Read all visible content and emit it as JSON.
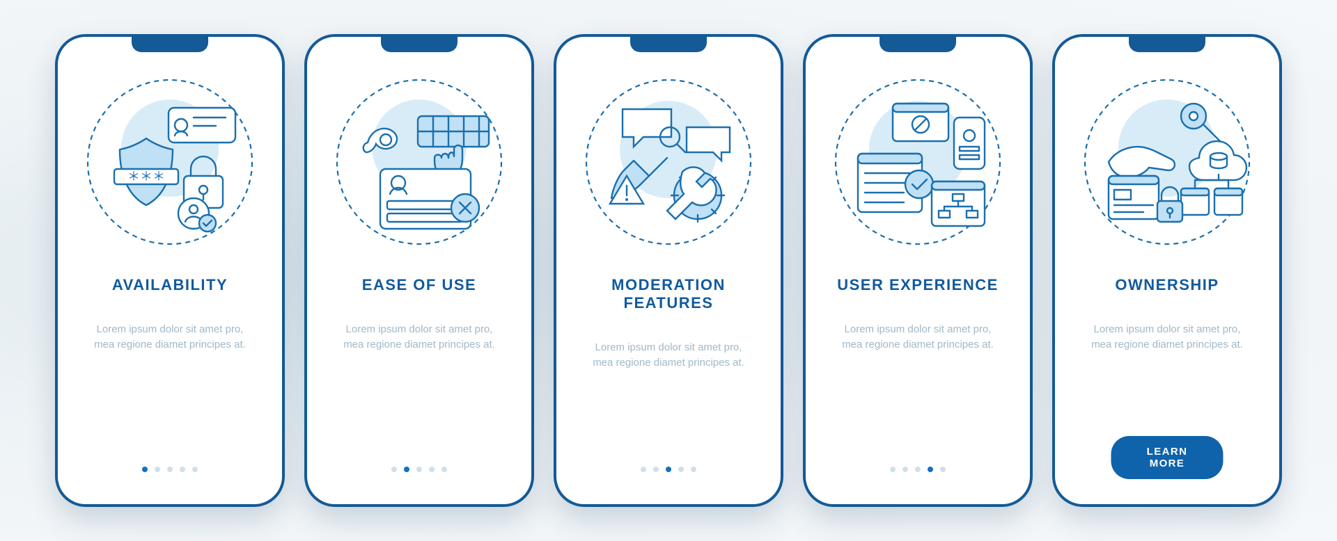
{
  "colors": {
    "primary": "#145a96",
    "accent": "#1a6fae",
    "fill": "#bfe0f5",
    "muted": "#9fb8c9"
  },
  "screens": [
    {
      "icon": "availability-icon",
      "title": "AVAILABILITY",
      "description": "Lorem ipsum dolor sit amet pro, mea regione diamet principes at.",
      "activeDot": 0,
      "dotCount": 5,
      "showDots": true,
      "cta": null
    },
    {
      "icon": "ease-of-use-icon",
      "title": "EASE OF USE",
      "description": "Lorem ipsum dolor sit amet pro, mea regione diamet principes at.",
      "activeDot": 1,
      "dotCount": 5,
      "showDots": true,
      "cta": null
    },
    {
      "icon": "moderation-features-icon",
      "title": "MODERATION FEATURES",
      "description": "Lorem ipsum dolor sit amet pro, mea regione diamet principes at.",
      "activeDot": 2,
      "dotCount": 5,
      "showDots": true,
      "cta": null
    },
    {
      "icon": "user-experience-icon",
      "title": "USER EXPERIENCE",
      "description": "Lorem ipsum dolor sit amet pro, mea regione diamet principes at.",
      "activeDot": 3,
      "dotCount": 5,
      "showDots": true,
      "cta": null
    },
    {
      "icon": "ownership-icon",
      "title": "OWNERSHIP",
      "description": "Lorem ipsum dolor sit amet pro, mea regione diamet principes at.",
      "activeDot": 4,
      "dotCount": 5,
      "showDots": false,
      "cta": "LEARN MORE"
    }
  ]
}
